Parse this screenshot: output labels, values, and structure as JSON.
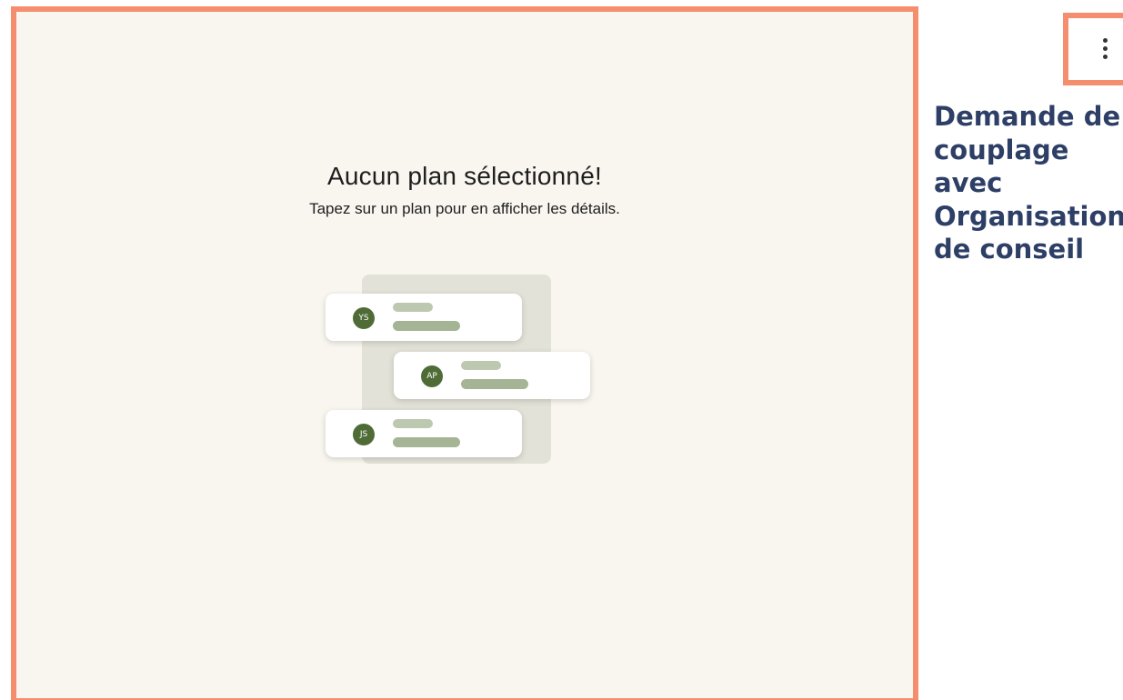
{
  "empty_state": {
    "title": "Aucun plan sélectionné!",
    "subtitle": "Tapez sur un plan pour en afficher les détails."
  },
  "illustration": {
    "cards": [
      {
        "initials": "YS"
      },
      {
        "initials": "AP"
      },
      {
        "initials": "JS"
      }
    ]
  },
  "side_panel": {
    "more_icon": "more-vertical-icon",
    "request_title": "Demande de\ncouplage\navec\nOrganisation\nde conseil"
  },
  "colors": {
    "highlight_border": "#f58d6f",
    "panel_background": "#f9f6f0",
    "avatar_green": "#4f6b36",
    "title_navy": "#2d3f66"
  }
}
